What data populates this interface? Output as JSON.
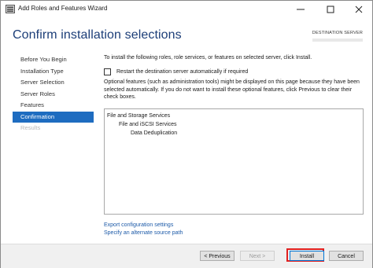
{
  "window": {
    "title": "Add Roles and Features Wizard"
  },
  "header": {
    "title": "Confirm installation selections",
    "destination_label": "DESTINATION SERVER"
  },
  "nav": {
    "items": [
      {
        "label": "Before You Begin",
        "state": "normal"
      },
      {
        "label": "Installation Type",
        "state": "normal"
      },
      {
        "label": "Server Selection",
        "state": "normal"
      },
      {
        "label": "Server Roles",
        "state": "normal"
      },
      {
        "label": "Features",
        "state": "normal"
      },
      {
        "label": "Confirmation",
        "state": "active"
      },
      {
        "label": "Results",
        "state": "disabled"
      }
    ]
  },
  "content": {
    "intro": "To install the following roles, role services, or features on selected server, click Install.",
    "restart_label": "Restart the destination server automatically if required",
    "restart_checked": false,
    "optional_text": "Optional features (such as administration tools) might be displayed on this page because they have been selected automatically. If you do not want to install these optional features, click Previous to clear their check boxes.",
    "tree": [
      {
        "label": "File and Storage Services",
        "level": 1
      },
      {
        "label": "File and iSCSI Services",
        "level": 2
      },
      {
        "label": "Data Deduplication",
        "level": 3
      }
    ],
    "links": {
      "export": "Export configuration settings",
      "alternate_source": "Specify an alternate source path"
    }
  },
  "footer": {
    "previous": "< Previous",
    "next": "Next >",
    "install": "Install",
    "cancel": "Cancel"
  },
  "colors": {
    "accent": "#1e6cc0",
    "title": "#1c3e78",
    "link": "#1c5aa8",
    "highlight": "#e02020"
  }
}
